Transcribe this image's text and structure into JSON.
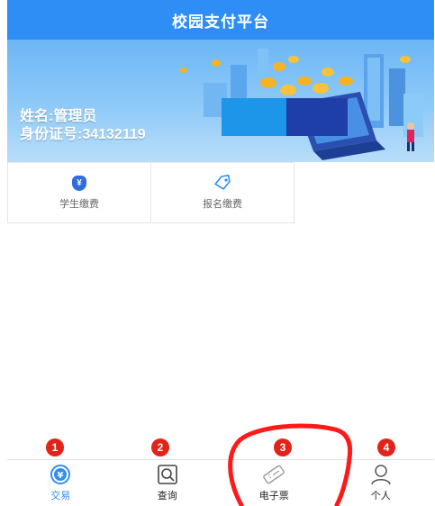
{
  "header": {
    "title": "校园支付平台"
  },
  "banner": {
    "name_line": "姓名:管理员",
    "id_line": "身份证号:34132119"
  },
  "tiles": [
    {
      "label": "学生缴费",
      "icon": "money-bag-icon",
      "glyph": "¥"
    },
    {
      "label": "报名缴费",
      "icon": "tag-icon"
    }
  ],
  "nav": [
    {
      "label": "交易",
      "icon": "yuan-circle-icon",
      "glyph": "¥",
      "active": true
    },
    {
      "label": "查询",
      "icon": "search-icon"
    },
    {
      "label": "电子票",
      "icon": "ticket-icon"
    },
    {
      "label": "个人",
      "icon": "person-icon"
    }
  ],
  "badges": [
    "1",
    "2",
    "3",
    "4"
  ],
  "colors": {
    "primary": "#2f8ef5",
    "badge": "#e2231a",
    "annotation": "#ff1a1a"
  }
}
